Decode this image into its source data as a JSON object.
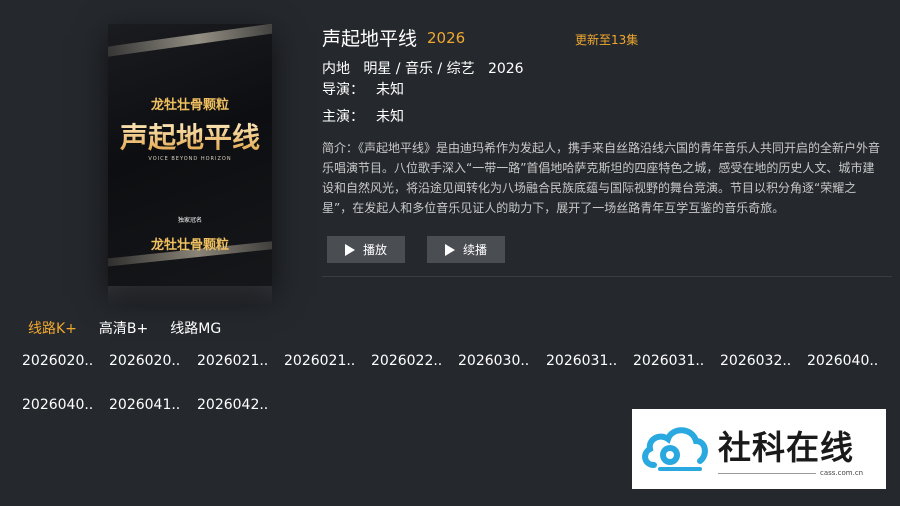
{
  "poster": {
    "top_text": "龙牡壮骨颗粒",
    "title": "声起地平线",
    "subtitle_en": "VOICE BEYOND HORIZON",
    "small_text": "独家冠名",
    "bottom_text": "龙牡壮骨颗粒"
  },
  "detail": {
    "title": "声起地平线",
    "year": "2026",
    "update": "更新至13集",
    "region": "内地",
    "genre": "明星 / 音乐 / 综艺",
    "meta_year": "2026",
    "director_label": "导演：",
    "director": "未知",
    "cast_label": "主演：",
    "cast": "未知",
    "description": "简介：《声起地平线》是由迪玛希作为发起人，携手来自丝路沿线六国的青年音乐人共同开启的全新户外音乐唱演节目。八位歌手深入“一带一路”首倡地哈萨克斯坦的四座特色之城，感受在地的历史人文、城市建设和自然风光，将沿途见闻转化为八场融合民族底蕴与国际视野的舞台竞演。节目以积分角逐“荣耀之星”，在发起人和多位音乐见证人的助力下，展开了一场丝路青年互学互鉴的音乐奇旅。"
  },
  "buttons": {
    "play": "播放",
    "resume": "续播"
  },
  "routes": [
    "线路K+",
    "高清B+",
    "线路MG"
  ],
  "episodes": [
    "2026020..",
    "2026020..",
    "2026021..",
    "2026021..",
    "2026022..",
    "2026030..",
    "2026031..",
    "2026031..",
    "2026032..",
    "2026040..",
    "2026040..",
    "2026041..",
    "2026042.."
  ],
  "watermark": {
    "name": "社科在线",
    "url": "cass.com.cn"
  },
  "colors": {
    "accent": "#f0a830",
    "background": "#25282d",
    "button": "#4a4d52"
  }
}
